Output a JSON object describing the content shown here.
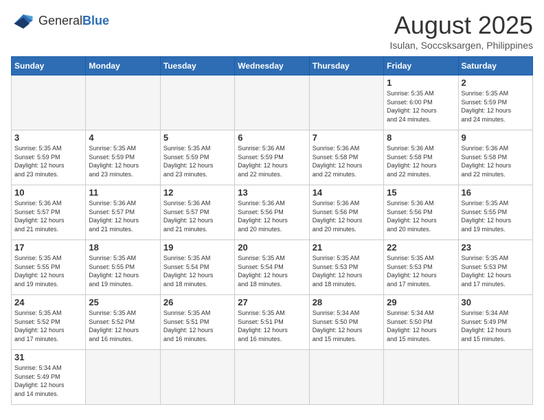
{
  "header": {
    "logo_general": "General",
    "logo_blue": "Blue",
    "title": "August 2025",
    "subtitle": "Isulan, Soccsksargen, Philippines"
  },
  "weekdays": [
    "Sunday",
    "Monday",
    "Tuesday",
    "Wednesday",
    "Thursday",
    "Friday",
    "Saturday"
  ],
  "weeks": [
    [
      {
        "day": "",
        "info": ""
      },
      {
        "day": "",
        "info": ""
      },
      {
        "day": "",
        "info": ""
      },
      {
        "day": "",
        "info": ""
      },
      {
        "day": "",
        "info": ""
      },
      {
        "day": "1",
        "info": "Sunrise: 5:35 AM\nSunset: 6:00 PM\nDaylight: 12 hours\nand 24 minutes."
      },
      {
        "day": "2",
        "info": "Sunrise: 5:35 AM\nSunset: 5:59 PM\nDaylight: 12 hours\nand 24 minutes."
      }
    ],
    [
      {
        "day": "3",
        "info": "Sunrise: 5:35 AM\nSunset: 5:59 PM\nDaylight: 12 hours\nand 23 minutes."
      },
      {
        "day": "4",
        "info": "Sunrise: 5:35 AM\nSunset: 5:59 PM\nDaylight: 12 hours\nand 23 minutes."
      },
      {
        "day": "5",
        "info": "Sunrise: 5:35 AM\nSunset: 5:59 PM\nDaylight: 12 hours\nand 23 minutes."
      },
      {
        "day": "6",
        "info": "Sunrise: 5:36 AM\nSunset: 5:59 PM\nDaylight: 12 hours\nand 22 minutes."
      },
      {
        "day": "7",
        "info": "Sunrise: 5:36 AM\nSunset: 5:58 PM\nDaylight: 12 hours\nand 22 minutes."
      },
      {
        "day": "8",
        "info": "Sunrise: 5:36 AM\nSunset: 5:58 PM\nDaylight: 12 hours\nand 22 minutes."
      },
      {
        "day": "9",
        "info": "Sunrise: 5:36 AM\nSunset: 5:58 PM\nDaylight: 12 hours\nand 22 minutes."
      }
    ],
    [
      {
        "day": "10",
        "info": "Sunrise: 5:36 AM\nSunset: 5:57 PM\nDaylight: 12 hours\nand 21 minutes."
      },
      {
        "day": "11",
        "info": "Sunrise: 5:36 AM\nSunset: 5:57 PM\nDaylight: 12 hours\nand 21 minutes."
      },
      {
        "day": "12",
        "info": "Sunrise: 5:36 AM\nSunset: 5:57 PM\nDaylight: 12 hours\nand 21 minutes."
      },
      {
        "day": "13",
        "info": "Sunrise: 5:36 AM\nSunset: 5:56 PM\nDaylight: 12 hours\nand 20 minutes."
      },
      {
        "day": "14",
        "info": "Sunrise: 5:36 AM\nSunset: 5:56 PM\nDaylight: 12 hours\nand 20 minutes."
      },
      {
        "day": "15",
        "info": "Sunrise: 5:36 AM\nSunset: 5:56 PM\nDaylight: 12 hours\nand 20 minutes."
      },
      {
        "day": "16",
        "info": "Sunrise: 5:35 AM\nSunset: 5:55 PM\nDaylight: 12 hours\nand 19 minutes."
      }
    ],
    [
      {
        "day": "17",
        "info": "Sunrise: 5:35 AM\nSunset: 5:55 PM\nDaylight: 12 hours\nand 19 minutes."
      },
      {
        "day": "18",
        "info": "Sunrise: 5:35 AM\nSunset: 5:55 PM\nDaylight: 12 hours\nand 19 minutes."
      },
      {
        "day": "19",
        "info": "Sunrise: 5:35 AM\nSunset: 5:54 PM\nDaylight: 12 hours\nand 18 minutes."
      },
      {
        "day": "20",
        "info": "Sunrise: 5:35 AM\nSunset: 5:54 PM\nDaylight: 12 hours\nand 18 minutes."
      },
      {
        "day": "21",
        "info": "Sunrise: 5:35 AM\nSunset: 5:53 PM\nDaylight: 12 hours\nand 18 minutes."
      },
      {
        "day": "22",
        "info": "Sunrise: 5:35 AM\nSunset: 5:53 PM\nDaylight: 12 hours\nand 17 minutes."
      },
      {
        "day": "23",
        "info": "Sunrise: 5:35 AM\nSunset: 5:53 PM\nDaylight: 12 hours\nand 17 minutes."
      }
    ],
    [
      {
        "day": "24",
        "info": "Sunrise: 5:35 AM\nSunset: 5:52 PM\nDaylight: 12 hours\nand 17 minutes."
      },
      {
        "day": "25",
        "info": "Sunrise: 5:35 AM\nSunset: 5:52 PM\nDaylight: 12 hours\nand 16 minutes."
      },
      {
        "day": "26",
        "info": "Sunrise: 5:35 AM\nSunset: 5:51 PM\nDaylight: 12 hours\nand 16 minutes."
      },
      {
        "day": "27",
        "info": "Sunrise: 5:35 AM\nSunset: 5:51 PM\nDaylight: 12 hours\nand 16 minutes."
      },
      {
        "day": "28",
        "info": "Sunrise: 5:34 AM\nSunset: 5:50 PM\nDaylight: 12 hours\nand 15 minutes."
      },
      {
        "day": "29",
        "info": "Sunrise: 5:34 AM\nSunset: 5:50 PM\nDaylight: 12 hours\nand 15 minutes."
      },
      {
        "day": "30",
        "info": "Sunrise: 5:34 AM\nSunset: 5:49 PM\nDaylight: 12 hours\nand 15 minutes."
      }
    ],
    [
      {
        "day": "31",
        "info": "Sunrise: 5:34 AM\nSunset: 5:49 PM\nDaylight: 12 hours\nand 14 minutes."
      },
      {
        "day": "",
        "info": ""
      },
      {
        "day": "",
        "info": ""
      },
      {
        "day": "",
        "info": ""
      },
      {
        "day": "",
        "info": ""
      },
      {
        "day": "",
        "info": ""
      },
      {
        "day": "",
        "info": ""
      }
    ]
  ]
}
